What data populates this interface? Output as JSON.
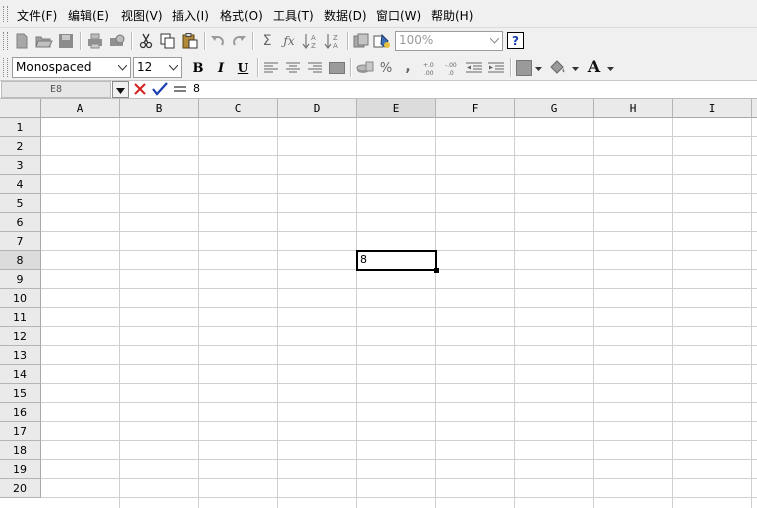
{
  "menu": {
    "items": [
      "文件(F)",
      "编辑(E)",
      "视图(V)",
      "插入(I)",
      "格式(O)",
      "工具(T)",
      "数据(D)",
      "窗口(W)",
      "帮助(H)"
    ]
  },
  "toolbar1": {
    "zoom_value": "100%",
    "help_label": "?"
  },
  "toolbar2": {
    "font_name": "Monospaced",
    "font_size": "12",
    "bold_label": "B",
    "italic_label": "I",
    "underline_label": "U",
    "percent_label": "%",
    "comma_label": ",",
    "font_color_label": "A"
  },
  "formula_bar": {
    "cell_ref": "E8",
    "content": "8"
  },
  "sheet": {
    "columns": [
      "A",
      "B",
      "C",
      "D",
      "E",
      "F",
      "G",
      "H",
      "I"
    ],
    "rows": [
      "1",
      "2",
      "3",
      "4",
      "5",
      "6",
      "7",
      "8",
      "9",
      "10",
      "11",
      "12",
      "13",
      "14",
      "15",
      "16",
      "17",
      "18",
      "19",
      "20"
    ],
    "active_column": "E",
    "active_row": "8",
    "active_cell_value": "8"
  },
  "colors": {
    "toolbar_bg": "#f0f0f0",
    "header_bg": "#eaeaea",
    "grid_line": "#cfcfcf",
    "cancel_red": "#d42020",
    "accept_blue": "#1a3fb0"
  }
}
